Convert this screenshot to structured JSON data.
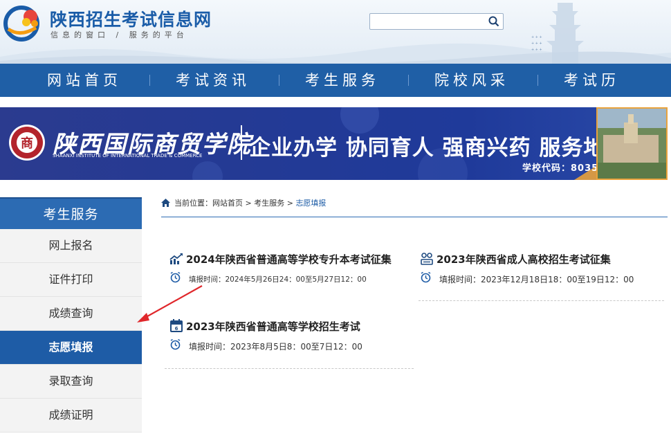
{
  "header": {
    "site_title": "陕西招生考试信息网",
    "site_slogan": "信息的窗口 / 服务的平台",
    "search": {
      "placeholder": "",
      "value": ""
    }
  },
  "nav": {
    "items": [
      {
        "label": "网站首页"
      },
      {
        "label": "考试资讯"
      },
      {
        "label": "考生服务"
      },
      {
        "label": "院校风采"
      },
      {
        "label": "考试历"
      }
    ]
  },
  "banner": {
    "school_name": "陕西国际商贸学院",
    "school_name_en": "SHAANXI INSTITUTE OF INTERNATIONAL TRADE & COMMERCE",
    "emblem_char": "商",
    "slogan": "企业办学 协同育人 强商兴药 服务地方",
    "school_code": "学校代码：8035"
  },
  "sidebar": {
    "title": "考生服务",
    "items": [
      {
        "label": "网上报名",
        "active": false
      },
      {
        "label": "证件打印",
        "active": false
      },
      {
        "label": "成绩查询",
        "active": false
      },
      {
        "label": "志愿填报",
        "active": true
      },
      {
        "label": "录取查询",
        "active": false
      },
      {
        "label": "成绩证明",
        "active": false
      }
    ]
  },
  "breadcrumb": {
    "prefix": "当前位置：",
    "items": [
      "网站首页",
      "考生服务",
      "志愿填报"
    ],
    "separator": " > "
  },
  "cards": [
    {
      "icon": "chart-trend-icon",
      "title": "2024年陕西省普通高等学校专升本考试征集",
      "time": "填报时间：2024年5月26日24：00至5月27日12：00"
    },
    {
      "icon": "people-group-icon",
      "title": "2023年陕西省成人高校招生考试征集",
      "time": "填报时间：2023年12月18日18：00至19日12：00"
    },
    {
      "icon": "calendar-exam-icon",
      "title": "2023年陕西省普通高等学校招生考试",
      "time": "填报时间：2023年8月5日8：00至7日12：00"
    }
  ],
  "colors": {
    "primary": "#1f5fa6",
    "accent_title": "#1a5ca8",
    "annotation_arrow": "#e0272b"
  }
}
